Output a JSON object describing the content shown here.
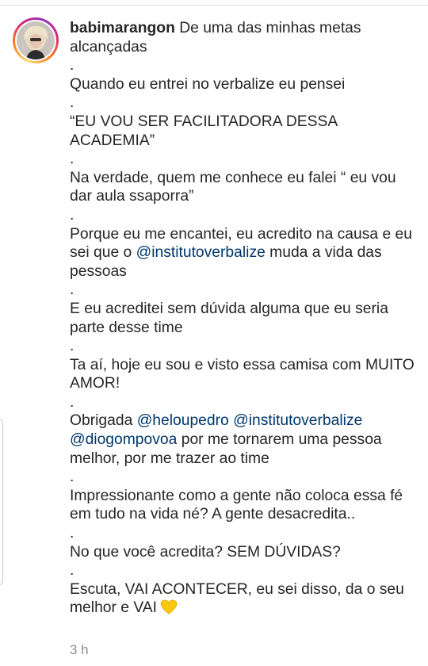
{
  "post": {
    "username": "babimarangon",
    "title_text": "De uma das minhas metas alcançadas",
    "lines": {
      "dot1": ".",
      "l1": "Quando eu entrei no verbalize eu pensei",
      "dot2": ".",
      "l2": "“EU VOU SER FACILITADORA DESSA ACADEMIA”",
      "dot3": ".",
      "l3": "Na verdade, quem me conhece eu falei “ eu vou dar aula ssaporra”",
      "dot4": ".",
      "l4a": "Porque eu me encantei, eu acredito na causa e eu sei que o",
      "l4_mention": "@institutoverbalize",
      "l4b": "muda a vida das pessoas",
      "dot5": ".",
      "l5": "E eu acreditei sem dúvida alguma que eu seria parte desse time",
      "dot6": ".",
      "l6": "Ta aí, hoje eu sou e visto essa camisa com MUITO AMOR!",
      "dot7": ".",
      "l7a": "Obrigada",
      "l7_mention1": "@heloupedro",
      "l7_mention2": "@institutoverbalize",
      "l7_mention3": "@diogompovoa",
      "l7b": "por me tornarem uma pessoa melhor, por me trazer ao time",
      "dot8": ".",
      "l8": "Impressionante como a gente não coloca essa fé em tudo na vida né? A gente desacredita..",
      "dot9": ".",
      "l9": "No que você acredita? SEM DÚVIDAS?",
      "dot10": ".",
      "l10": "Escuta, VAI ACONTECER, eu sei disso, da o seu melhor e VAI"
    },
    "emoji": "yellow-heart-icon",
    "timestamp": "3 h"
  },
  "colors": {
    "text": "#262626",
    "mention": "#00376b",
    "muted": "#8e8e8e",
    "heart": "#f9c80e"
  }
}
